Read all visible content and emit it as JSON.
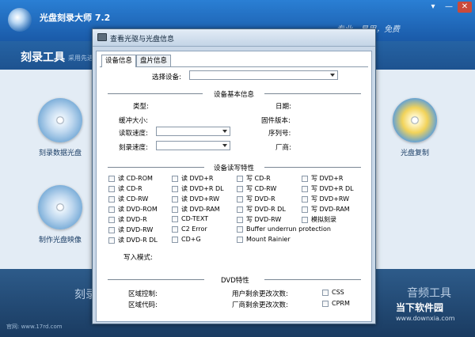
{
  "app": {
    "title": "光盘刻录大师 7.2",
    "slogan": "专业，易用，免费",
    "nav_title": "刻录工具",
    "nav_sub": "采用先进",
    "features": {
      "burn_data": "刻录数据光盘",
      "make_image": "制作光盘映像",
      "copy_disc": "光盘复制"
    },
    "bottom": {
      "left_label": "刻录",
      "right_label": "音频工具"
    },
    "site": "官网: www.17rd.com",
    "watermark": "当下软件园",
    "watermark_url": "www.downxia.com",
    "window_buttons": [
      "▾",
      "—",
      "✕"
    ]
  },
  "dialog": {
    "title": "查看光驱与光盘信息",
    "tabs": [
      "设备信息",
      "盘片信息"
    ],
    "select_device_label": "选择设备:",
    "basic_info": {
      "title": "设备基本信息",
      "type": "类型:",
      "buffer": "缓冲大小:",
      "read_speed": "读取速度:",
      "write_speed": "刻录速度:",
      "date": "日期:",
      "firmware": "固件版本:",
      "serial": "序列号:",
      "vendor": "厂商:"
    },
    "rw_features": {
      "title": "设备读写特性",
      "col1": [
        "读 CD-ROM",
        "读 CD-R",
        "读 CD-RW",
        "读 DVD-ROM",
        "读 DVD-R",
        "读 DVD-RW",
        "读 DVD-R DL"
      ],
      "col2": [
        "读 DVD+R",
        "读 DVD+R DL",
        "读 DVD+RW",
        "读 DVD-RAM",
        "CD-TEXT",
        "C2 Error",
        "CD+G"
      ],
      "col3": [
        "写 CD-R",
        "写 CD-RW",
        "写 DVD-R",
        "写 DVD-R DL",
        "写 DVD-RW"
      ],
      "col4": [
        "写 DVD+R",
        "写 DVD+R DL",
        "写 DVD+RW",
        "写 DVD-RAM",
        "模拟刻录"
      ],
      "wide": [
        "Buffer underrun protection",
        "Mount Rainier"
      ],
      "write_mode": "写入模式:"
    },
    "dvd": {
      "title": "DVD特性",
      "region_control": "区域控制:",
      "region_code": "区域代码:",
      "user_changes": "用户剩余更改次数:",
      "vendor_changes": "厂商剩余更改次数:",
      "css": "CSS",
      "cprm": "CPRM"
    }
  }
}
